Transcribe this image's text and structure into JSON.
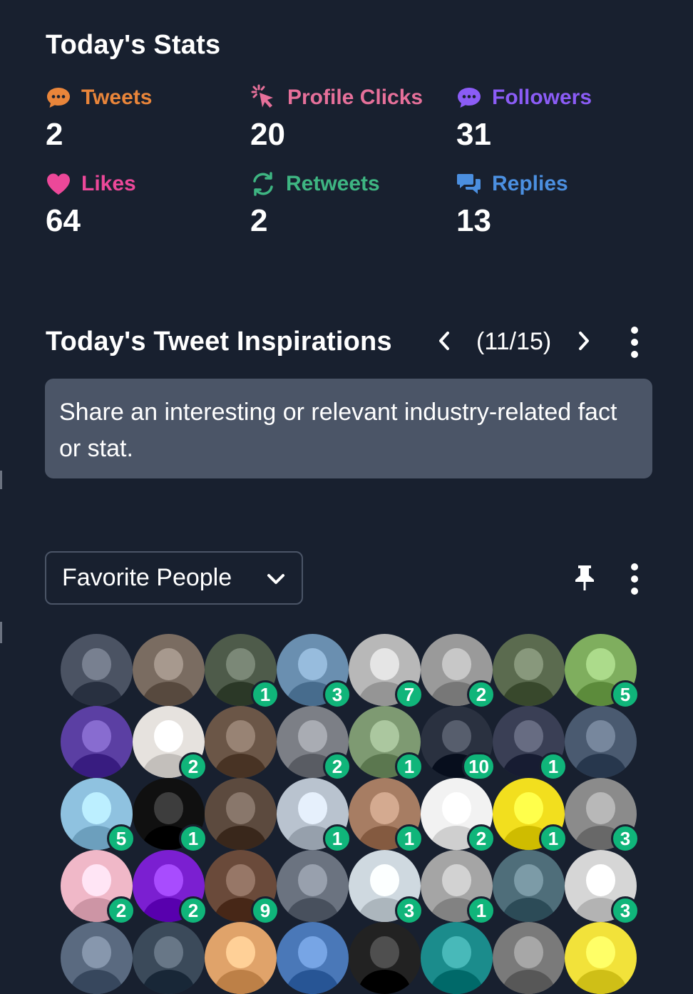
{
  "stats": {
    "title": "Today's Stats",
    "items": [
      {
        "label": "Tweets",
        "value": "2",
        "color": "#e9853a",
        "icon": "chat-bubble-icon"
      },
      {
        "label": "Profile Clicks",
        "value": "20",
        "color": "#e6709a",
        "icon": "cursor-click-icon"
      },
      {
        "label": "Followers",
        "value": "31",
        "color": "#8b5cf6",
        "icon": "chat-bubble-icon"
      },
      {
        "label": "Likes",
        "value": "64",
        "color": "#ec4899",
        "icon": "heart-icon"
      },
      {
        "label": "Retweets",
        "value": "2",
        "color": "#3eb582",
        "icon": "refresh-icon"
      },
      {
        "label": "Replies",
        "value": "13",
        "color": "#4b8fe0",
        "icon": "chat-bubbles-icon"
      }
    ]
  },
  "inspirations": {
    "title": "Today's Tweet Inspirations",
    "counter": "(11/15)",
    "text": "Share an interesting or relevant industry-related fact or stat."
  },
  "favorites": {
    "selected": "Favorite People",
    "avatars": [
      {
        "badge": "",
        "color": "#4b5363"
      },
      {
        "badge": "",
        "color": "#7a6c61"
      },
      {
        "badge": "1",
        "color": "#4e5b4a"
      },
      {
        "badge": "3",
        "color": "#6a8fb0"
      },
      {
        "badge": "7",
        "color": "#b8b8b8"
      },
      {
        "badge": "2",
        "color": "#9a9a9a"
      },
      {
        "badge": "",
        "color": "#5b6b4f"
      },
      {
        "badge": "5",
        "color": "#7fae5e"
      },
      {
        "badge": "",
        "color": "#5b3fa3"
      },
      {
        "badge": "2",
        "color": "#e6e2de"
      },
      {
        "badge": "",
        "color": "#6b5647"
      },
      {
        "badge": "2",
        "color": "#7c7f86"
      },
      {
        "badge": "1",
        "color": "#7e9a72"
      },
      {
        "badge": "10",
        "color": "#2a3140"
      },
      {
        "badge": "1",
        "color": "#3a3f55"
      },
      {
        "badge": "",
        "color": "#4a5a70"
      },
      {
        "badge": "5",
        "color": "#8fc2e0"
      },
      {
        "badge": "1",
        "color": "#101010"
      },
      {
        "badge": "",
        "color": "#5c4a3e"
      },
      {
        "badge": "1",
        "color": "#b9c3cf"
      },
      {
        "badge": "1",
        "color": "#a77d63"
      },
      {
        "badge": "2",
        "color": "#f2f2f2"
      },
      {
        "badge": "1",
        "color": "#f2df1e"
      },
      {
        "badge": "3",
        "color": "#8b8b8b"
      },
      {
        "badge": "2",
        "color": "#f0b8c8"
      },
      {
        "badge": "2",
        "color": "#7b1fd1"
      },
      {
        "badge": "9",
        "color": "#6a4a3a"
      },
      {
        "badge": "",
        "color": "#6b7380"
      },
      {
        "badge": "3",
        "color": "#cfd9e0"
      },
      {
        "badge": "1",
        "color": "#a5a5a5"
      },
      {
        "badge": "",
        "color": "#4f6e7a"
      },
      {
        "badge": "3",
        "color": "#d6d6d6"
      },
      {
        "badge": "",
        "color": "#5a6a80"
      },
      {
        "badge": "",
        "color": "#3b4a5a"
      },
      {
        "badge": "",
        "color": "#e0a36a"
      },
      {
        "badge": "",
        "color": "#4a78b8"
      },
      {
        "badge": "",
        "color": "#222222"
      },
      {
        "badge": "",
        "color": "#1b8c8c"
      },
      {
        "badge": "",
        "color": "#7a7a7a"
      },
      {
        "badge": "",
        "color": "#f2e23a"
      }
    ]
  }
}
